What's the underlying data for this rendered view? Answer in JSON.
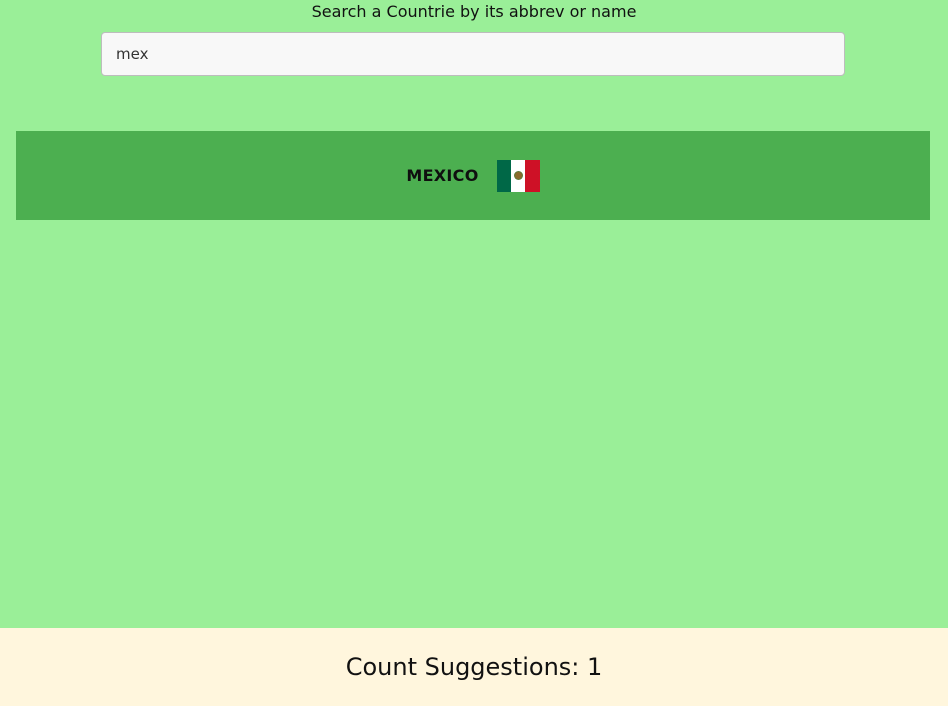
{
  "search": {
    "label": "Search a Countrie by its abbrev or name",
    "value": "mex"
  },
  "results": [
    {
      "name": "MEXICO",
      "flag_icon": "mexico-flag-icon"
    }
  ],
  "footer": {
    "count_label": "Count Suggestions: 1"
  },
  "colors": {
    "background": "#9aef98",
    "result_bg": "#4caf50",
    "footer_bg": "#fff6dd"
  }
}
